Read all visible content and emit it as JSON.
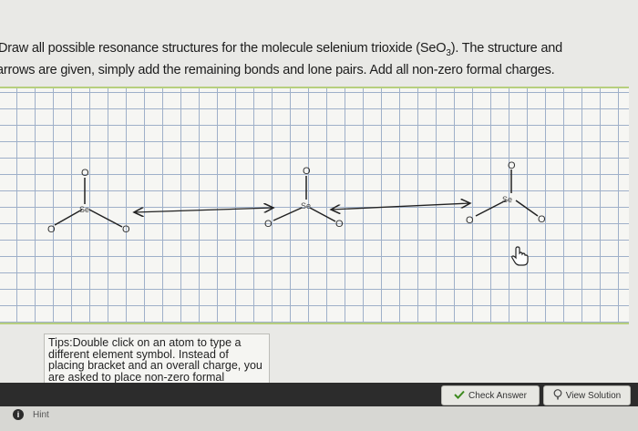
{
  "question": {
    "line1_pre": "Draw all possible resonance structures for the molecule selenium trioxide (SeO",
    "line1_sub": "3",
    "line1_post": "). The structure and",
    "line2": "arrows are given, simply add the remaining bonds and lone pairs. Add all non-zero formal charges."
  },
  "structures": [
    {
      "center": "Se",
      "top": "O",
      "left": "O",
      "right": "O"
    },
    {
      "center": "Se",
      "top": "O",
      "left": "O",
      "right": "O"
    },
    {
      "center": "Se",
      "top": "O",
      "left": "O",
      "right": "O"
    }
  ],
  "tips": {
    "text": "Tips:Double click on an atom to type a different element symbol. Instead of placing bracket and an overall charge, you are asked to place non-zero formal charges. To do this click on the +/–"
  },
  "buttons": {
    "check_answer": "Check Answer",
    "view_solution": "View Solution"
  },
  "hint": {
    "label": "Hint"
  },
  "colors": {
    "grid_line": "#9fb0c9",
    "canvas_border": "#b7cf7e",
    "toolbar": "#2c2c2c"
  },
  "icons": {
    "check": "check-icon",
    "solution": "lightbulb-icon",
    "hint": "info-icon",
    "cursor": "hand-cursor-icon"
  }
}
